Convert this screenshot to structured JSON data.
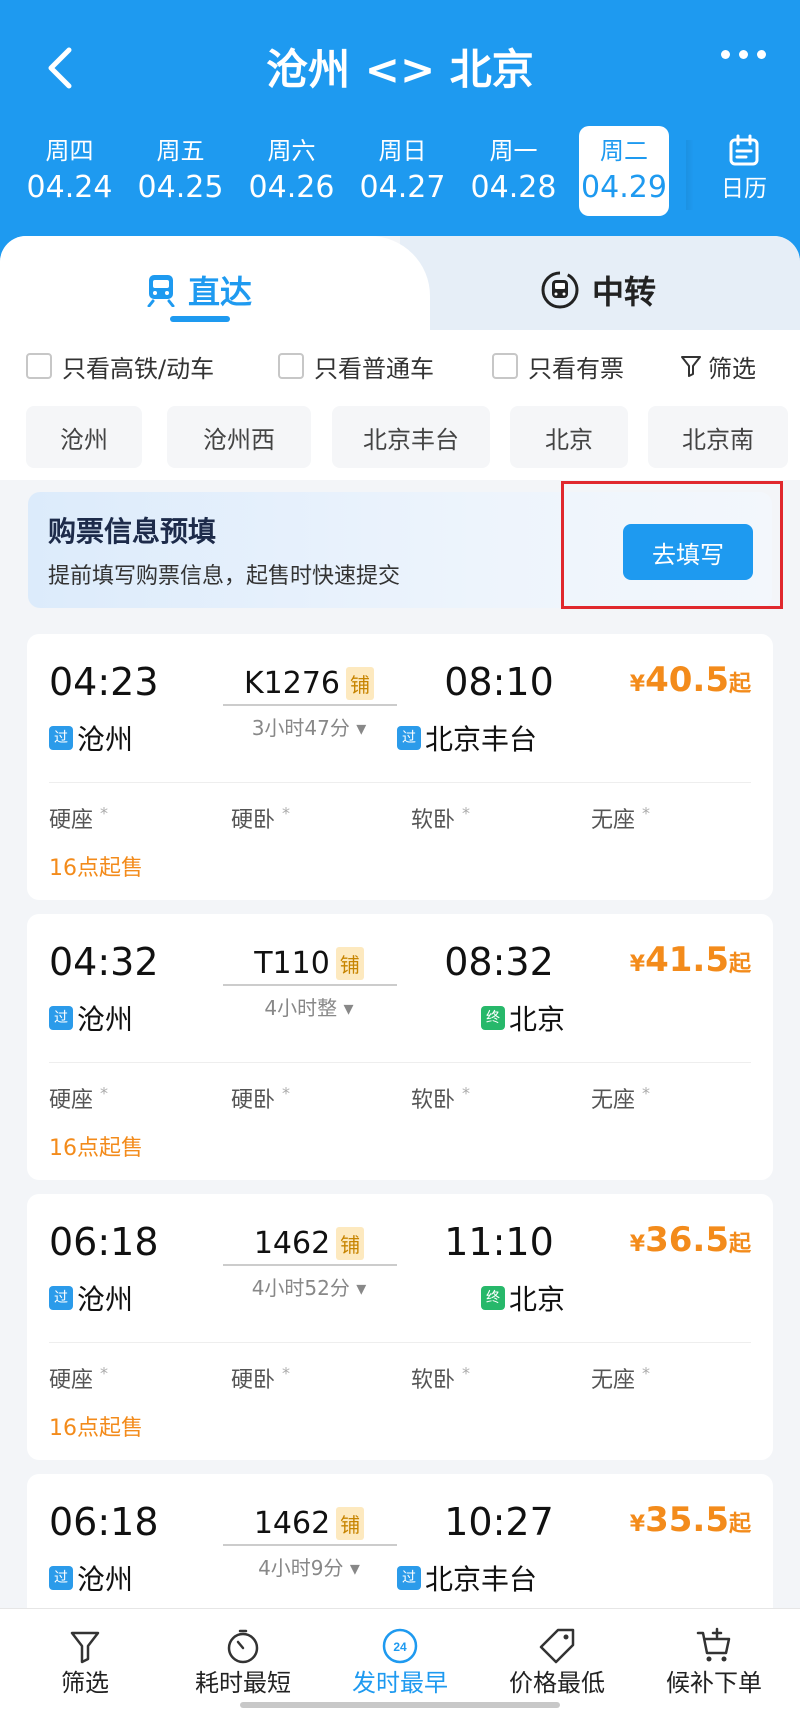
{
  "header": {
    "title": "沧州 <> 北京",
    "dates": [
      {
        "weekday": "周四",
        "date": "04.24"
      },
      {
        "weekday": "周五",
        "date": "04.25"
      },
      {
        "weekday": "周六",
        "date": "04.26"
      },
      {
        "weekday": "周日",
        "date": "04.27"
      },
      {
        "weekday": "周一",
        "date": "04.28"
      },
      {
        "weekday": "周二",
        "date": "04.29"
      }
    ],
    "calendar_label": "日历"
  },
  "tabs": {
    "direct": "直达",
    "transfer": "中转"
  },
  "filters": {
    "high_speed": "只看高铁/动车",
    "normal": "只看普通车",
    "available": "只看有票",
    "filter": "筛选"
  },
  "stations": [
    "沧州",
    "沧州西",
    "北京丰台",
    "北京",
    "北京南"
  ],
  "prefill": {
    "title": "购票信息预填",
    "subtitle": "提前填写购票信息，起售时快速提交",
    "button": "去填写"
  },
  "trains": [
    {
      "dep_time": "04:23",
      "train_no": "K1276",
      "berth_tag": "铺",
      "duration": "3小时47分",
      "arr_time": "08:10",
      "price": "40.5",
      "dep_tag": "过",
      "dep_station": "沧州",
      "arr_tag": "过",
      "arr_station": "北京丰台",
      "sale": "16点起售"
    },
    {
      "dep_time": "04:32",
      "train_no": "T110",
      "berth_tag": "铺",
      "duration": "4小时整",
      "arr_time": "08:32",
      "price": "41.5",
      "dep_tag": "过",
      "dep_station": "沧州",
      "arr_tag": "终",
      "arr_station": "北京",
      "sale": "16点起售"
    },
    {
      "dep_time": "06:18",
      "train_no": "1462",
      "berth_tag": "铺",
      "duration": "4小时52分",
      "arr_time": "11:10",
      "price": "36.5",
      "dep_tag": "过",
      "dep_station": "沧州",
      "arr_tag": "终",
      "arr_station": "北京",
      "sale": "16点起售"
    },
    {
      "dep_time": "06:18",
      "train_no": "1462",
      "berth_tag": "铺",
      "duration": "4小时9分",
      "arr_time": "10:27",
      "price": "35.5",
      "dep_tag": "过",
      "dep_station": "沧州",
      "arr_tag": "过",
      "arr_station": "北京丰台",
      "sale": ""
    }
  ],
  "seats": [
    "硬座",
    "硬卧",
    "软卧",
    "无座"
  ],
  "seat_mark": "*",
  "currency": "¥",
  "price_suffix": "起",
  "bottom_nav": [
    {
      "label": "筛选",
      "icon": "filter-icon"
    },
    {
      "label": "耗时最短",
      "icon": "timer-icon"
    },
    {
      "label": "发时最早",
      "icon": "clock-24-icon"
    },
    {
      "label": "价格最低",
      "icon": "price-tag-icon"
    },
    {
      "label": "候补下单",
      "icon": "cart-add-icon"
    }
  ],
  "colors": {
    "brand": "#1e9af0",
    "price": "#f38b1b",
    "highlight_box": "#e0282d"
  }
}
